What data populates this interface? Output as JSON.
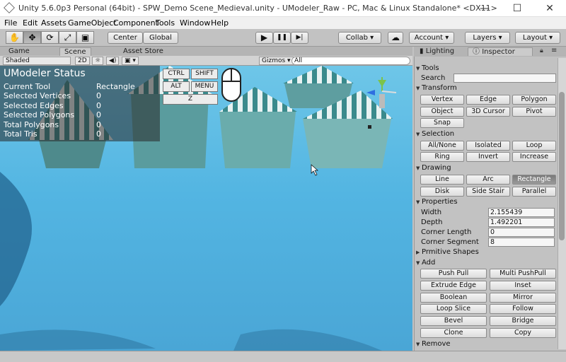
{
  "window": {
    "title": "Unity 5.6.0p3 Personal (64bit) - SPW_Demo Scene_Medieval.unity - UModeler_Raw - PC, Mac & Linux Standalone* <DX11>",
    "minimize": "—",
    "maximize": "☐",
    "close": "✕"
  },
  "menu": [
    "File",
    "Edit",
    "Assets",
    "GameObject",
    "Component",
    "Tools",
    "Window",
    "Help"
  ],
  "toolbar": {
    "tools": [
      "✋",
      "✥",
      "⟳",
      "⤢",
      "▣"
    ],
    "pivot": "Center",
    "space": "Global",
    "play": "▶",
    "pause": "❚❚",
    "step": "▶|",
    "collab": "Collab ▾",
    "cloud": "☁",
    "account": "Account ▾",
    "layers": "Layers ▾",
    "layout": "Layout ▾"
  },
  "left_tabs": [
    "Game",
    "Scene",
    "Asset Store"
  ],
  "scene_bar": {
    "shading": "Shaded",
    "mode2d": "2D",
    "light": "☼",
    "audio": "◀)",
    "fx": "▣ ▾",
    "gizmos": "Gizmos ▾",
    "search_placeholder": "All"
  },
  "umodeler_status": {
    "heading": "UModeler Status",
    "rows": [
      {
        "label": "Current Tool",
        "value": "Rectangle"
      },
      {
        "label": "Selected Vertices",
        "value": "0"
      },
      {
        "label": "Selected Edges",
        "value": "0"
      },
      {
        "label": "Selected Polygons",
        "value": "0"
      },
      {
        "label": "Total Polygons",
        "value": "0"
      },
      {
        "label": "Total Tris",
        "value": "0"
      }
    ],
    "keys": {
      "ctrl": "CTRL",
      "shift": "SHIFT",
      "alt": "ALT",
      "menu": "MENU",
      "z": "Z"
    }
  },
  "right_tabs": [
    "Lighting",
    "Inspector"
  ],
  "inspector": {
    "tools_label": "Tools",
    "search_label": "Search",
    "search_value": "",
    "transform": {
      "label": "Transform",
      "buttons": [
        "Vertex",
        "Edge",
        "Polygon",
        "Object",
        "3D Cursor",
        "Pivot",
        "Snap"
      ]
    },
    "selection": {
      "label": "Selection",
      "buttons": [
        "All/None",
        "Isolated",
        "Loop",
        "Ring",
        "Invert",
        "Increase"
      ]
    },
    "drawing": {
      "label": "Drawing",
      "buttons": [
        "Line",
        "Arc",
        "Rectangle",
        "Disk",
        "Side Stair",
        "Parallel"
      ],
      "selected": "Rectangle"
    },
    "properties": {
      "label": "Properties",
      "fields": [
        {
          "label": "Width",
          "value": "2.155439"
        },
        {
          "label": "Depth",
          "value": "1.492201"
        },
        {
          "label": "Corner Length",
          "value": "0"
        },
        {
          "label": "Corner Segment",
          "value": "8"
        }
      ]
    },
    "primitive_label": "Prmitive Shapes",
    "add": {
      "label": "Add",
      "buttons": [
        "Push Pull",
        "Multi PushPull",
        "Extrude Edge",
        "Inset",
        "Boolean",
        "Mirror",
        "Loop Slice",
        "Follow",
        "Bevel",
        "Bridge",
        "Clone",
        "Copy"
      ]
    },
    "remove_label": "Remove"
  },
  "colors": {
    "accent_selected": "#7a7a7a",
    "scene_sky": "#53b5e2",
    "tent_stripe": "#e8f2f2",
    "tent_dark": "#3a7a7c"
  }
}
